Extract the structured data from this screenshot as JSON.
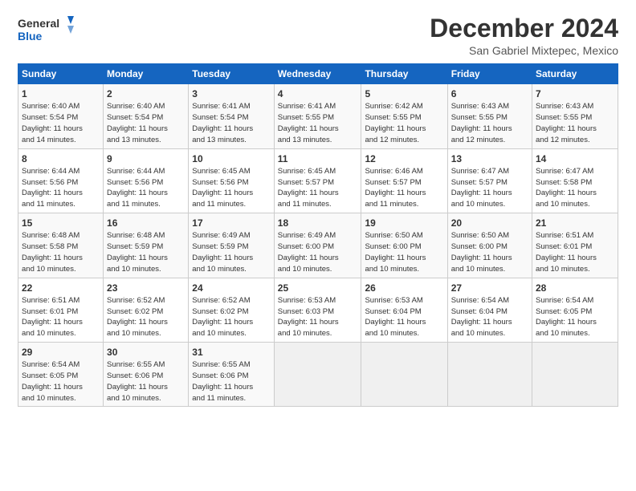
{
  "logo": {
    "line1": "General",
    "line2": "Blue"
  },
  "title": "December 2024",
  "location": "San Gabriel Mixtepec, Mexico",
  "days_of_week": [
    "Sunday",
    "Monday",
    "Tuesday",
    "Wednesday",
    "Thursday",
    "Friday",
    "Saturday"
  ],
  "weeks": [
    [
      {
        "day": "1",
        "sunrise": "6:40 AM",
        "sunset": "5:54 PM",
        "daylight": "11 hours and 14 minutes."
      },
      {
        "day": "2",
        "sunrise": "6:40 AM",
        "sunset": "5:54 PM",
        "daylight": "11 hours and 13 minutes."
      },
      {
        "day": "3",
        "sunrise": "6:41 AM",
        "sunset": "5:54 PM",
        "daylight": "11 hours and 13 minutes."
      },
      {
        "day": "4",
        "sunrise": "6:41 AM",
        "sunset": "5:55 PM",
        "daylight": "11 hours and 13 minutes."
      },
      {
        "day": "5",
        "sunrise": "6:42 AM",
        "sunset": "5:55 PM",
        "daylight": "11 hours and 12 minutes."
      },
      {
        "day": "6",
        "sunrise": "6:43 AM",
        "sunset": "5:55 PM",
        "daylight": "11 hours and 12 minutes."
      },
      {
        "day": "7",
        "sunrise": "6:43 AM",
        "sunset": "5:55 PM",
        "daylight": "11 hours and 12 minutes."
      }
    ],
    [
      {
        "day": "8",
        "sunrise": "6:44 AM",
        "sunset": "5:56 PM",
        "daylight": "11 hours and 11 minutes."
      },
      {
        "day": "9",
        "sunrise": "6:44 AM",
        "sunset": "5:56 PM",
        "daylight": "11 hours and 11 minutes."
      },
      {
        "day": "10",
        "sunrise": "6:45 AM",
        "sunset": "5:56 PM",
        "daylight": "11 hours and 11 minutes."
      },
      {
        "day": "11",
        "sunrise": "6:45 AM",
        "sunset": "5:57 PM",
        "daylight": "11 hours and 11 minutes."
      },
      {
        "day": "12",
        "sunrise": "6:46 AM",
        "sunset": "5:57 PM",
        "daylight": "11 hours and 11 minutes."
      },
      {
        "day": "13",
        "sunrise": "6:47 AM",
        "sunset": "5:57 PM",
        "daylight": "11 hours and 10 minutes."
      },
      {
        "day": "14",
        "sunrise": "6:47 AM",
        "sunset": "5:58 PM",
        "daylight": "11 hours and 10 minutes."
      }
    ],
    [
      {
        "day": "15",
        "sunrise": "6:48 AM",
        "sunset": "5:58 PM",
        "daylight": "11 hours and 10 minutes."
      },
      {
        "day": "16",
        "sunrise": "6:48 AM",
        "sunset": "5:59 PM",
        "daylight": "11 hours and 10 minutes."
      },
      {
        "day": "17",
        "sunrise": "6:49 AM",
        "sunset": "5:59 PM",
        "daylight": "11 hours and 10 minutes."
      },
      {
        "day": "18",
        "sunrise": "6:49 AM",
        "sunset": "6:00 PM",
        "daylight": "11 hours and 10 minutes."
      },
      {
        "day": "19",
        "sunrise": "6:50 AM",
        "sunset": "6:00 PM",
        "daylight": "11 hours and 10 minutes."
      },
      {
        "day": "20",
        "sunrise": "6:50 AM",
        "sunset": "6:00 PM",
        "daylight": "11 hours and 10 minutes."
      },
      {
        "day": "21",
        "sunrise": "6:51 AM",
        "sunset": "6:01 PM",
        "daylight": "11 hours and 10 minutes."
      }
    ],
    [
      {
        "day": "22",
        "sunrise": "6:51 AM",
        "sunset": "6:01 PM",
        "daylight": "11 hours and 10 minutes."
      },
      {
        "day": "23",
        "sunrise": "6:52 AM",
        "sunset": "6:02 PM",
        "daylight": "11 hours and 10 minutes."
      },
      {
        "day": "24",
        "sunrise": "6:52 AM",
        "sunset": "6:02 PM",
        "daylight": "11 hours and 10 minutes."
      },
      {
        "day": "25",
        "sunrise": "6:53 AM",
        "sunset": "6:03 PM",
        "daylight": "11 hours and 10 minutes."
      },
      {
        "day": "26",
        "sunrise": "6:53 AM",
        "sunset": "6:04 PM",
        "daylight": "11 hours and 10 minutes."
      },
      {
        "day": "27",
        "sunrise": "6:54 AM",
        "sunset": "6:04 PM",
        "daylight": "11 hours and 10 minutes."
      },
      {
        "day": "28",
        "sunrise": "6:54 AM",
        "sunset": "6:05 PM",
        "daylight": "11 hours and 10 minutes."
      }
    ],
    [
      {
        "day": "29",
        "sunrise": "6:54 AM",
        "sunset": "6:05 PM",
        "daylight": "11 hours and 10 minutes."
      },
      {
        "day": "30",
        "sunrise": "6:55 AM",
        "sunset": "6:06 PM",
        "daylight": "11 hours and 10 minutes."
      },
      {
        "day": "31",
        "sunrise": "6:55 AM",
        "sunset": "6:06 PM",
        "daylight": "11 hours and 11 minutes."
      },
      null,
      null,
      null,
      null
    ]
  ]
}
